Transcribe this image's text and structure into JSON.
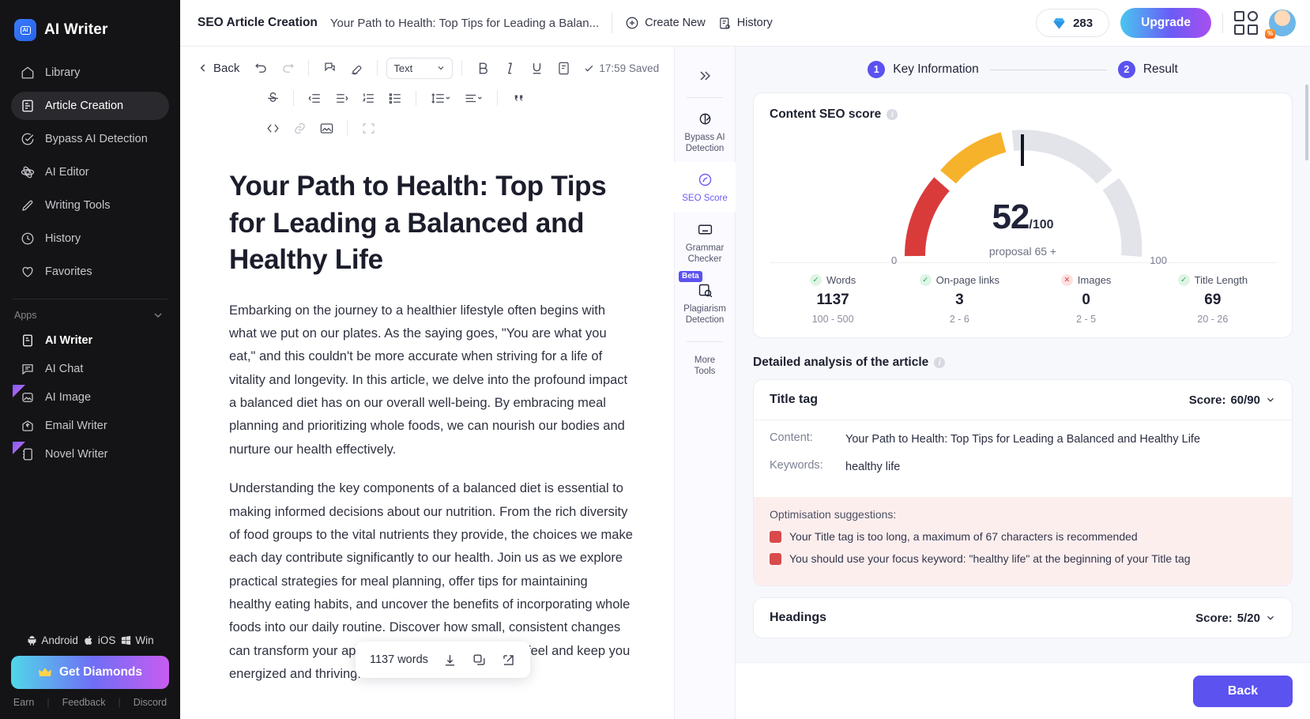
{
  "sidebar": {
    "brand": "AI Writer",
    "nav": [
      {
        "label": "Library",
        "icon": "home-icon"
      },
      {
        "label": "Article Creation",
        "icon": "document-icon"
      },
      {
        "label": "Bypass AI Detection",
        "icon": "check-circle-icon"
      },
      {
        "label": "AI Editor",
        "icon": "atom-icon"
      },
      {
        "label": "Writing Tools",
        "icon": "pencil-icon"
      },
      {
        "label": "History",
        "icon": "clock-icon"
      },
      {
        "label": "Favorites",
        "icon": "heart-icon"
      }
    ],
    "apps_label": "Apps",
    "apps": [
      {
        "label": "AI Writer",
        "icon": "writer-icon"
      },
      {
        "label": "AI Chat",
        "icon": "chat-icon"
      },
      {
        "label": "AI Image",
        "icon": "image-icon"
      },
      {
        "label": "Email Writer",
        "icon": "email-icon"
      },
      {
        "label": "Novel Writer",
        "icon": "book-icon"
      }
    ],
    "platforms": [
      {
        "label": "Android",
        "icon": "android-icon"
      },
      {
        "label": "iOS",
        "icon": "apple-icon"
      },
      {
        "label": "Win",
        "icon": "windows-icon"
      }
    ],
    "get_diamonds": "Get Diamonds",
    "links": [
      "Earn",
      "Feedback",
      "Discord"
    ]
  },
  "topbar": {
    "title": "SEO Article Creation",
    "doc_name": "Your Path to Health: Top Tips for Leading a Balan...",
    "create_new": "Create New",
    "history": "History",
    "credits": "283",
    "upgrade": "Upgrade"
  },
  "editor": {
    "back": "Back",
    "text_style": "Text",
    "saved": "17:59 Saved",
    "article_title": "Your Path to Health: Top Tips for Leading a Balanced and Healthy Life",
    "paragraphs": [
      "Embarking on the journey to a healthier lifestyle often begins with what we put on our plates. As the saying goes, \"You are what you eat,\" and this couldn't be more accurate when striving for a life of vitality and longevity. In this article, we delve into the profound impact a balanced diet has on our overall well-being. By embracing meal planning and prioritizing whole foods, we can nourish our bodies and nurture our health effectively.",
      "Understanding the key components of a balanced diet is essential to making informed decisions about our nutrition. From the rich diversity of food groups to the vital nutrients they provide, the choices we make each day contribute significantly to our health. Join us as we explore practical strategies for meal planning, offer tips for maintaining healthy eating habits, and uncover the benefits of incorporating whole foods into our daily routine. Discover how small, consistent changes can transform your approach to eating, helping you feel and keep you energized and thriving."
    ],
    "word_pill": "1137 words"
  },
  "rail": {
    "items": [
      {
        "label": "Bypass AI\nDetection",
        "icon": "bypass-icon",
        "active": false,
        "badge": ""
      },
      {
        "label": "SEO Score",
        "icon": "seo-icon",
        "active": true,
        "badge": ""
      },
      {
        "label": "Grammar\nChecker",
        "icon": "grammar-icon",
        "active": false,
        "badge": ""
      },
      {
        "label": "Plagiarism\nDetection",
        "icon": "plagiarism-icon",
        "active": false,
        "badge": "Beta"
      },
      {
        "label": "More\nTools",
        "icon": "more-icon",
        "active": false,
        "badge": ""
      }
    ]
  },
  "panel": {
    "steps": [
      {
        "num": "1",
        "label": "Key Information"
      },
      {
        "num": "2",
        "label": "Result"
      }
    ],
    "score_title": "Content SEO score",
    "gauge": {
      "value": "52",
      "max_label": "/100",
      "proposal": "proposal 65 +",
      "min": "0",
      "max": "100"
    },
    "metrics": [
      {
        "name": "Words",
        "value": "1137",
        "range": "100 - 500",
        "status": "ok"
      },
      {
        "name": "On-page links",
        "value": "3",
        "range": "2 - 6",
        "status": "ok"
      },
      {
        "name": "Images",
        "value": "0",
        "range": "2 - 5",
        "status": "bad"
      },
      {
        "name": "Title Length",
        "value": "69",
        "range": "20 - 26",
        "status": "ok"
      }
    ],
    "detail_title": "Detailed analysis of the article",
    "title_tag": {
      "heading": "Title tag",
      "score_label": "Score:",
      "score": "60/90",
      "content_key": "Content:",
      "content_value": "Your Path to Health: Top Tips for Leading a Balanced and Healthy Life",
      "keywords_key": "Keywords:",
      "keywords_value": "healthy life",
      "suggestions_label": "Optimisation suggestions:",
      "suggestions": [
        "Your Title tag is too long, a maximum of 67 characters is recommended",
        "You should use your focus keyword: \"healthy life\" at the beginning of your Title tag"
      ]
    },
    "headings": {
      "heading": "Headings",
      "score_label": "Score:",
      "score": "5/20"
    },
    "back_button": "Back"
  },
  "chart_data": {
    "type": "gauge",
    "title": "Content SEO score",
    "value": 52,
    "range": [
      0,
      100
    ],
    "proposal_threshold": 65,
    "segments": [
      {
        "name": "poor",
        "from": 0,
        "to": 33,
        "color": "#d93b3b"
      },
      {
        "name": "average",
        "from": 33,
        "to": 52,
        "color": "#f7b22b"
      },
      {
        "name": "remaining",
        "from": 52,
        "to": 100,
        "color": "#e3e4ea"
      }
    ],
    "needle_at": 52
  },
  "colors": {
    "accent": "#5b52f0",
    "danger": "#d94a4a",
    "warn": "#f7b22b",
    "ok": "#23a455"
  }
}
